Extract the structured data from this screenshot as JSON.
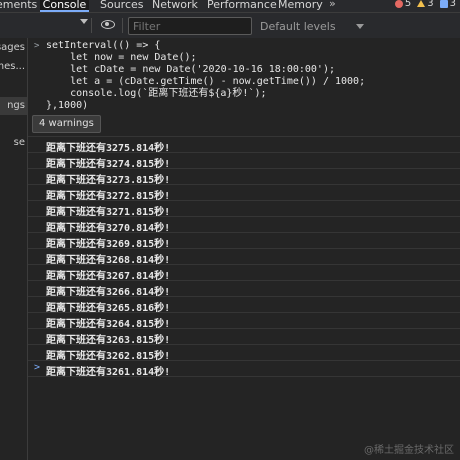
{
  "tabs": [
    {
      "label": "ements",
      "active": false
    },
    {
      "label": "Console",
      "active": true
    },
    {
      "label": "Sources",
      "active": false
    },
    {
      "label": "Network",
      "active": false
    },
    {
      "label": "Performance",
      "active": false
    },
    {
      "label": "Memory",
      "active": false
    }
  ],
  "more_tabs": "»",
  "counts": {
    "errors": "5",
    "warnings": "3",
    "info": "3"
  },
  "toolbar": {
    "filter_placeholder": "Filter",
    "levels_label": "Default levels"
  },
  "sidebar": {
    "items": [
      {
        "label": "sages"
      },
      {
        "label": "mes..."
      },
      {
        "label": "ngs"
      },
      {
        "label": "se"
      }
    ]
  },
  "code_lines": [
    "setInterval(() => {",
    "    let now = new Date();",
    "    let cDate = new Date('2020-10-16 18:00:00');",
    "    let a = (cDate.getTime() - now.getTime()) / 1000;",
    "    console.log(`距离下班还有${a}秒!`);",
    "},1000)"
  ],
  "tooltip": "4 warnings",
  "logs": [
    "距离下班还有3275.814秒!",
    "距离下班还有3274.815秒!",
    "距离下班还有3273.815秒!",
    "距离下班还有3272.815秒!",
    "距离下班还有3271.815秒!",
    "距离下班还有3270.814秒!",
    "距离下班还有3269.815秒!",
    "距离下班还有3268.814秒!",
    "距离下班还有3267.814秒!",
    "距离下班还有3266.814秒!",
    "距离下班还有3265.816秒!",
    "距离下班还有3264.815秒!",
    "距离下班还有3263.815秒!",
    "距离下班还有3262.815秒!",
    "距离下班还有3261.814秒!"
  ],
  "watermark": "@稀土掘金技术社区",
  "colors": {
    "accent": "#7cacf8",
    "error": "#e46962",
    "warning": "#f2c04e",
    "background": "#242424"
  }
}
